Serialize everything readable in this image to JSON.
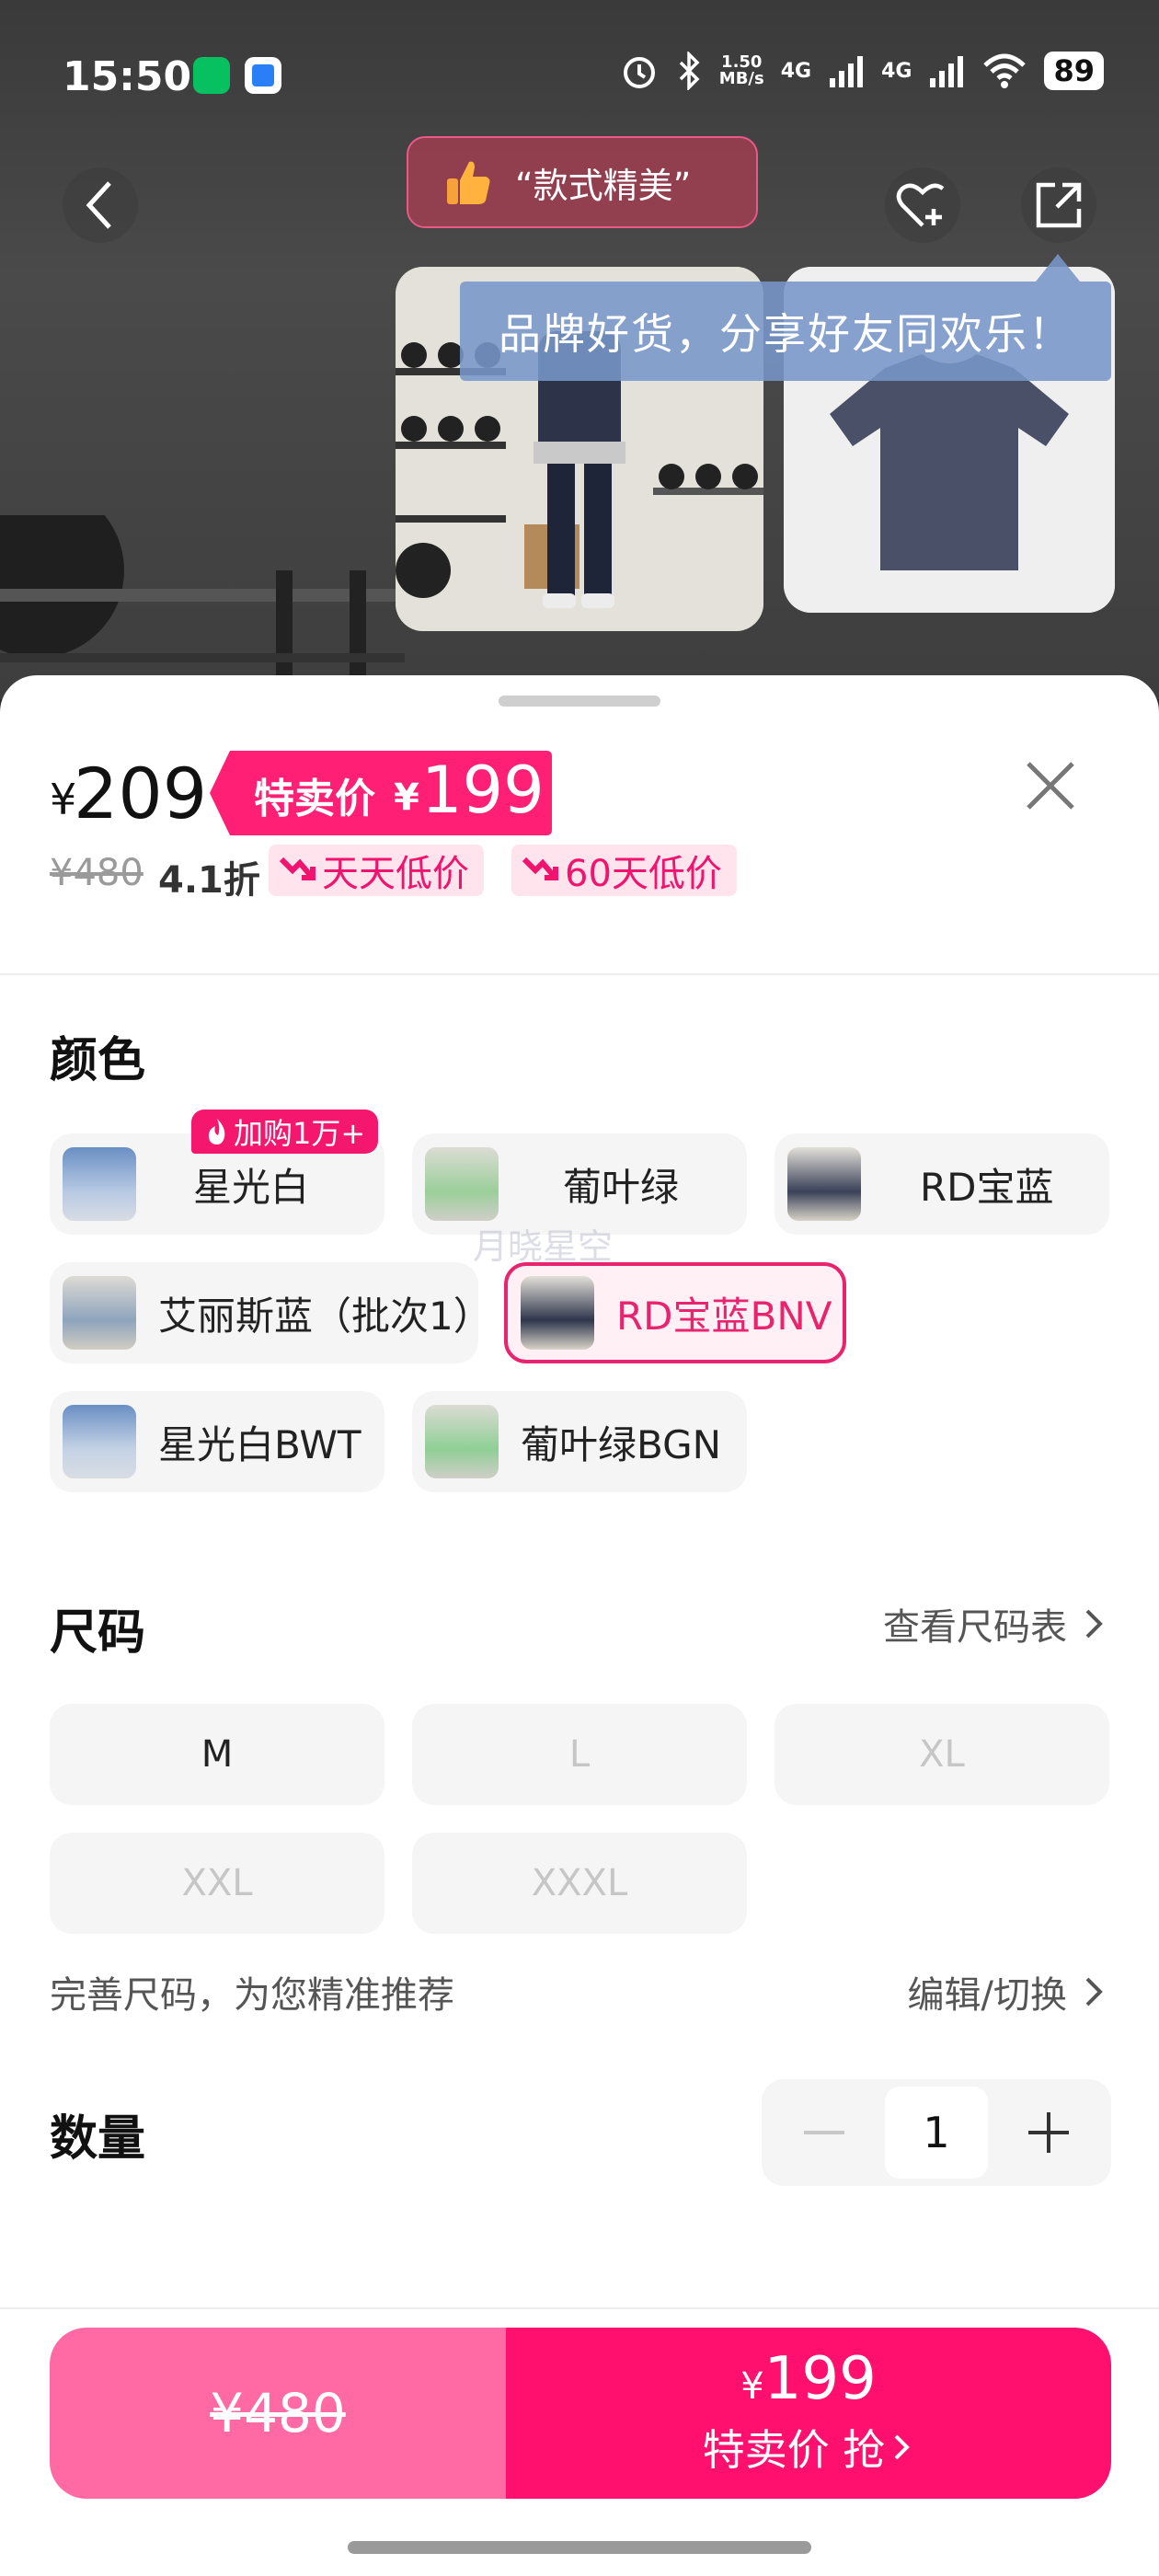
{
  "status_bar": {
    "time": "15:50",
    "net_speed": "1.50\nMB/s",
    "signal1": "4G",
    "signal2": "4G",
    "battery": "89"
  },
  "top_overlay": {
    "praise_text": "“款式精美”",
    "share_tooltip": "品牌好货，分享好友同欢乐！"
  },
  "price": {
    "currency": "¥",
    "current": "209",
    "promo_label": "特卖价",
    "promo_currency": "¥",
    "promo_price": "199",
    "original": "¥480",
    "discount": "4.1折",
    "tags": [
      "天天低价",
      "60天低价"
    ]
  },
  "color_section": {
    "title": "颜色",
    "hot_badge": "加购1万+",
    "options": [
      {
        "label": "星光白"
      },
      {
        "label": "葡叶绿"
      },
      {
        "label": "RD宝蓝"
      },
      {
        "label": "艾丽斯蓝（批次1）"
      },
      {
        "label": "RD宝蓝BNV"
      },
      {
        "label": "星光白BWT"
      },
      {
        "label": "葡叶绿BGN"
      }
    ],
    "selected_index": 4,
    "watermark": "月晓星空"
  },
  "size_section": {
    "title": "尺码",
    "size_chart_link": "查看尺码表",
    "sizes": [
      "M",
      "L",
      "XL",
      "XXL",
      "XXXL"
    ],
    "available": [
      "M"
    ],
    "hint": "完善尺码，为您精准推荐",
    "edit_link": "编辑/切换"
  },
  "quantity_section": {
    "title": "数量",
    "value": "1"
  },
  "bottom_bar": {
    "left_price": "¥480",
    "right_currency": "¥",
    "right_price": "199",
    "right_label": "特卖价 抢"
  },
  "colors": {
    "accent": "#ff0f6e",
    "accent_light": "#ff6aa5",
    "tag_bg": "#ffe4ee"
  }
}
